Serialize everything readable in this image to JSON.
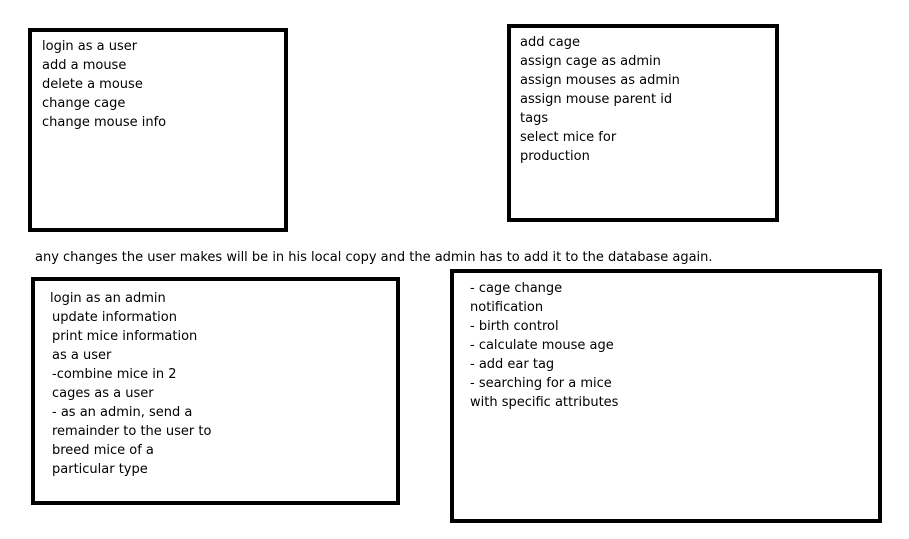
{
  "user_box": {
    "lines": [
      "login as a user",
      "add a mouse",
      "delete a mouse",
      "change cage",
      "change mouse info"
    ]
  },
  "admin_box": {
    "lines": [
      "add cage",
      "assign cage as admin",
      "assign mouses as admin",
      "assign mouse parent id",
      "tags",
      "select mice for",
      "production"
    ]
  },
  "note": {
    "text": "any changes the user makes will be in his local copy and the admin has to add it to the database again."
  },
  "admin_user_box": {
    "lines": [
      "login as an admin",
      "update information",
      "print mice information",
      "as a user",
      "-combine mice in 2",
      "cages as a user",
      "- as an admin, send a",
      "remainder to the user to",
      "breed mice of a",
      "particular type"
    ]
  },
  "features_box": {
    "lines": [
      "- cage change",
      "notification",
      "- birth control",
      "- calculate mouse age",
      "- add ear tag",
      "- searching for a mice",
      "with specific attributes"
    ]
  }
}
